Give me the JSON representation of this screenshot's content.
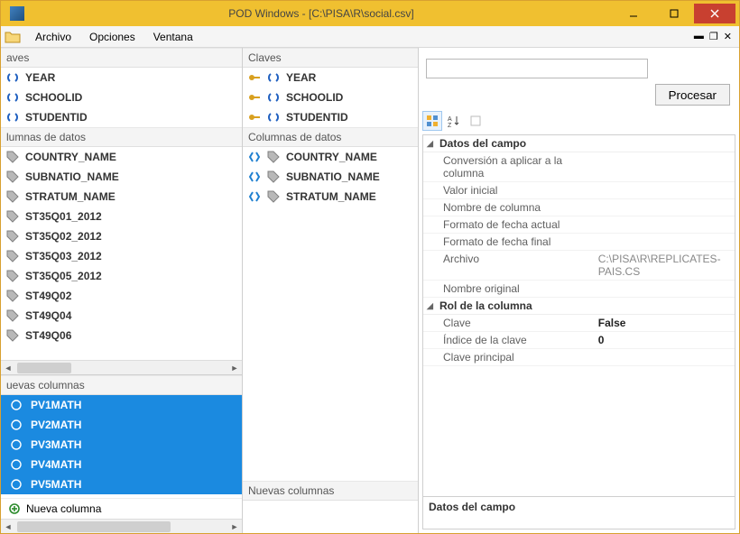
{
  "title": "POD Windows - [C:\\PISA\\R\\social.csv]",
  "menu": {
    "archivo": "Archivo",
    "opciones": "Opciones",
    "ventana": "Ventana"
  },
  "headers": {
    "claves": "Claves",
    "columnas": "Columnas de datos",
    "nuevas": "Nuevas columnas",
    "claves2": "aves",
    "columnas2": "lumnas de datos",
    "nuevas2": "uevas columnas",
    "nueva_col": "Nueva columna"
  },
  "keys": [
    "YEAR",
    "SCHOOLID",
    "STUDENTID"
  ],
  "columns_left": [
    "COUNTRY_NAME",
    "SUBNATIO_NAME",
    "STRATUM_NAME",
    "ST35Q01_2012",
    "ST35Q02_2012",
    "ST35Q03_2012",
    "ST35Q05_2012",
    "ST49Q02",
    "ST49Q04",
    "ST49Q06"
  ],
  "columns_mid": [
    "COUNTRY_NAME",
    "SUBNATIO_NAME",
    "STRATUM_NAME"
  ],
  "new_columns": [
    "PV1MATH",
    "PV2MATH",
    "PV3MATH",
    "PV4MATH",
    "PV5MATH"
  ],
  "right": {
    "procesar": "Procesar",
    "grid": {
      "cat1": "Datos del campo",
      "conv": "Conversión a aplicar a la columna",
      "valor_inicial": "Valor inicial",
      "nombre_col": "Nombre de columna",
      "fmt_actual": "Formato de fecha actual",
      "fmt_final": "Formato de fecha final",
      "archivo": "Archivo",
      "archivo_v": "C:\\PISA\\R\\REPLICATES-PAIS.CS",
      "nombre_orig": "Nombre original",
      "cat2": "Rol de la columna",
      "clave": "Clave",
      "clave_v": "False",
      "indice": "Índice de la clave",
      "indice_v": "0",
      "clave_prin": "Clave principal"
    },
    "desc": "Datos del campo"
  }
}
